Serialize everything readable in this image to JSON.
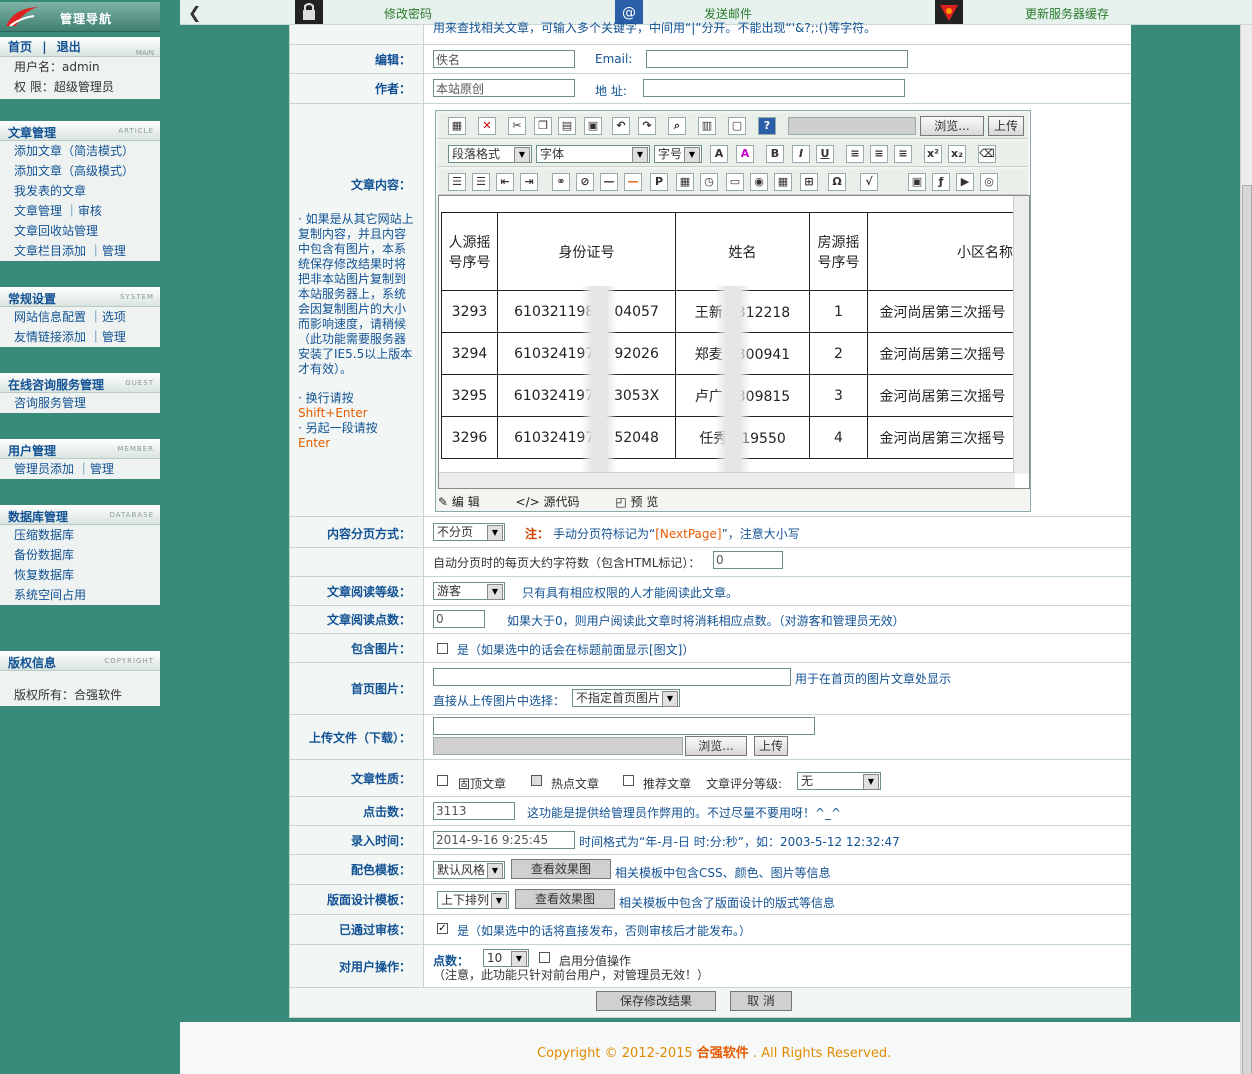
{
  "sidebar": {
    "logo_title": "管理导航",
    "top": {
      "home": "首页",
      "sep": "|",
      "logout": "退出",
      "en": "MAIN",
      "username": "用户名：admin",
      "perm": "权 限：超级管理员"
    },
    "sections": [
      {
        "title": "文章管理",
        "en": "ARTICLE",
        "items": [
          "添加文章（简洁模式）",
          "添加文章（高级模式）",
          "我发表的文章",
          "文章管理 ｜审核",
          "文章回收站管理",
          "文章栏目添加 ｜管理"
        ]
      },
      {
        "title": "常规设置",
        "en": "SYSTEM",
        "items": [
          "网站信息配置 ｜选项",
          "友情链接添加 ｜管理"
        ]
      },
      {
        "title": "在线咨询服务管理",
        "en": "GUEST",
        "items": [
          "咨询服务管理"
        ]
      },
      {
        "title": "用户管理",
        "en": "MEMBER",
        "items": [
          "管理员添加 ｜管理"
        ]
      },
      {
        "title": "数据库管理",
        "en": "DATABASE",
        "items": [
          "压缩数据库",
          "备份数据库",
          "恢复数据库",
          "系统空间占用"
        ]
      },
      {
        "title": "版权信息",
        "en": "COPYRIGHT",
        "items": [
          "版权所有：合强软件"
        ]
      }
    ]
  },
  "topbar": {
    "change_pwd": "修改密码",
    "send_mail": "发送邮件",
    "update_cache": "更新服务器缓存"
  },
  "form": {
    "hint_top": "用来查找相关文章，可输入多个关键字，中间用“|”分开。不能出现“'&?;:()等字符。",
    "editor_label": "编辑：",
    "editor_value": "佚名",
    "email_label": "Email:",
    "email_value": "",
    "author_label": "作者：",
    "author_value": "本站原创",
    "address_label": "地 址:",
    "address_value": "",
    "content_label": "文章内容：",
    "notes": "· 如果是从其它网站上复制内容，并且内容中包含有图片，本系统保存修改结果时将把非本站图片复制到本站服务器上，系统会因复制图片的大小而影响速度，请稍候（此功能需要服务器安装了IE5.5以上版本才有效）。",
    "note_newline": "· 换行请按",
    "note_newline_key": "Shift+Enter",
    "note_para": "· 另起一段请按",
    "note_para_key": "Enter",
    "editor": {
      "browse": "浏览...",
      "upload": "上传",
      "para_format": "段落格式",
      "font": "字体",
      "font_size": "字号",
      "table_header": [
        "人源摇号序号",
        "身份证号",
        "姓名",
        "房源摇号序号",
        "小区名称"
      ],
      "table_rows": [
        [
          "3293",
          "610321198",
          "04057",
          "王新",
          "312218",
          "1",
          "金河尚居第三次摇号"
        ],
        [
          "3294",
          "610324197",
          "92026",
          "郑麦",
          "300941",
          "2",
          "金河尚居第三次摇号"
        ],
        [
          "3295",
          "610324197",
          "3053X",
          "卢广",
          "309815",
          "3",
          "金河尚居第三次摇号"
        ],
        [
          "3296",
          "610324197",
          "52048",
          "任秀",
          "19550",
          "4",
          "金河尚居第三次摇号"
        ]
      ],
      "mode_edit": "编 辑",
      "mode_source": "源代码",
      "mode_preview": "预 览"
    },
    "paging_label": "内容分页方式：",
    "paging_value": "不分页",
    "paging_note_prefix": "注：",
    "paging_note": "手动分页符标记为“",
    "paging_note_tag": "[NextPage]",
    "paging_note_suffix": "”，注意大小写",
    "auto_page_text": "自动分页时的每页大约字符数（包含HTML标记）：",
    "auto_page_value": "0",
    "read_level_label": "文章阅读等级：",
    "read_level_value": "游客",
    "read_level_note": "只有具有相应权限的人才能阅读此文章。",
    "read_points_label": "文章阅读点数：",
    "read_points_value": "0",
    "read_points_note": "如果大于0，则用户阅读此文章时将消耗相应点数。（对游客和管理员无效）",
    "has_image_label": "包含图片：",
    "has_image_note": "是（如果选中的话会在标题前面显示[图文]）",
    "home_image_label": "首页图片：",
    "home_image_value": "",
    "home_image_note": "用于在首页的图片文章处显示",
    "home_image_pick": "直接从上传图片中选择：",
    "home_image_select": "不指定首页图片",
    "upload_label": "上传文件（下载）：",
    "upload_value": "",
    "upload_browse": "浏览...",
    "upload_btn": "上传",
    "nature_label": "文章性质：",
    "nature_top": "固顶文章",
    "nature_hot": "热点文章",
    "nature_recommend": "推荐文章",
    "nature_rating": "文章评分等级:",
    "nature_rating_value": "无",
    "hits_label": "点击数：",
    "hits_value": "3113",
    "hits_note": "这功能是提供给管理员作弊用的。不过尽量不要用呀！^_^",
    "time_label": "录入时间：",
    "time_value": "2014-9-16 9:25:45",
    "time_note": "时间格式为“年-月-日 时:分:秒”，如：2003-5-12 12:32:47",
    "template_label": "配色模板：",
    "template_value": "默认风格",
    "template_btn": "查看效果图",
    "template_note": "相关模板中包含CSS、颜色、图片等信息",
    "layout_label": "版面设计模板：",
    "layout_value": "上下排列",
    "layout_btn": "查看效果图",
    "layout_note": "相关模板中包含了版面设计的版式等信息",
    "approved_label": "已通过审核：",
    "approved_note": "是（如果选中的话将直接发布，否则审核后才能发布。）",
    "user_op_label": "对用户操作：",
    "user_op_points": "点数",
    "user_op_colon": "：",
    "user_op_value": "10",
    "user_op_enable": "启用分值操作",
    "user_op_note": "（注意，此功能只针对前台用户，对管理员无效！）",
    "save_btn": "保存修改结果",
    "cancel_btn": "取 消"
  },
  "footer": {
    "prefix": "Copyright © 2012-2015 ",
    "brand": "合强软件",
    "suffix": " . All Rights Reserved."
  }
}
